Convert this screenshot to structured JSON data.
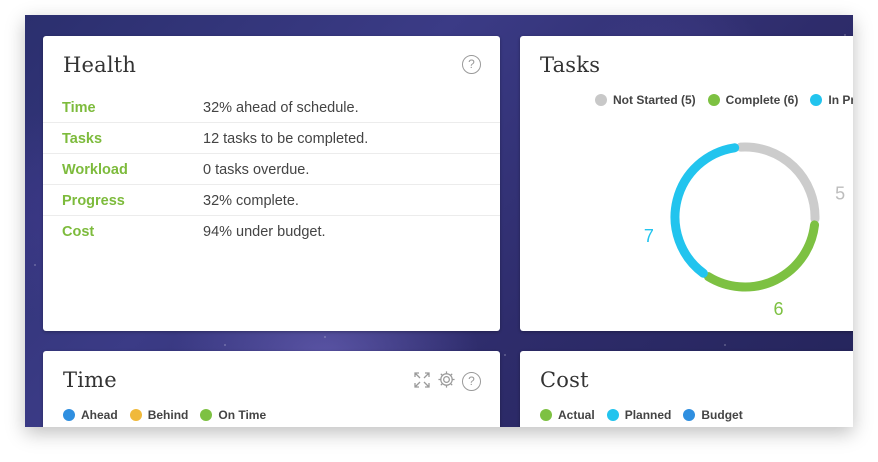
{
  "health": {
    "title": "Health",
    "help_icon": "?",
    "rows": [
      {
        "label": "Time",
        "value": "32% ahead of schedule."
      },
      {
        "label": "Tasks",
        "value": "12 tasks to be completed."
      },
      {
        "label": "Workload",
        "value": "0 tasks overdue."
      },
      {
        "label": "Progress",
        "value": "32% complete."
      },
      {
        "label": "Cost",
        "value": "94% under budget."
      }
    ]
  },
  "tasks": {
    "title": "Tasks",
    "legend": [
      {
        "label": "Not Started (5)",
        "color": "#c8c8c8"
      },
      {
        "label": "Complete (6)",
        "color": "#7dc142"
      },
      {
        "label": "In Pro",
        "color": "#22c4ee"
      }
    ]
  },
  "chart_data": {
    "type": "pie",
    "style": "donut",
    "series": [
      {
        "name": "Not Started",
        "value": 5,
        "color": "#cccccc",
        "label": "5"
      },
      {
        "name": "Complete",
        "value": 6,
        "color": "#7dc142",
        "label": "6"
      },
      {
        "name": "In Progress",
        "value": 7,
        "color": "#22c4ee",
        "label": "7"
      }
    ]
  },
  "time": {
    "title": "Time",
    "icons": {
      "expand": "expand-icon",
      "settings": "gear-icon",
      "help": "?"
    },
    "legend": [
      {
        "label": "Ahead",
        "color": "#2f8fe0"
      },
      {
        "label": "Behind",
        "color": "#f0b93a"
      },
      {
        "label": "On Time",
        "color": "#7dc142"
      }
    ]
  },
  "cost": {
    "title": "Cost",
    "legend": [
      {
        "label": "Actual",
        "color": "#7dc142"
      },
      {
        "label": "Planned",
        "color": "#22c4ee"
      },
      {
        "label": "Budget",
        "color": "#2f8fe0"
      }
    ]
  }
}
